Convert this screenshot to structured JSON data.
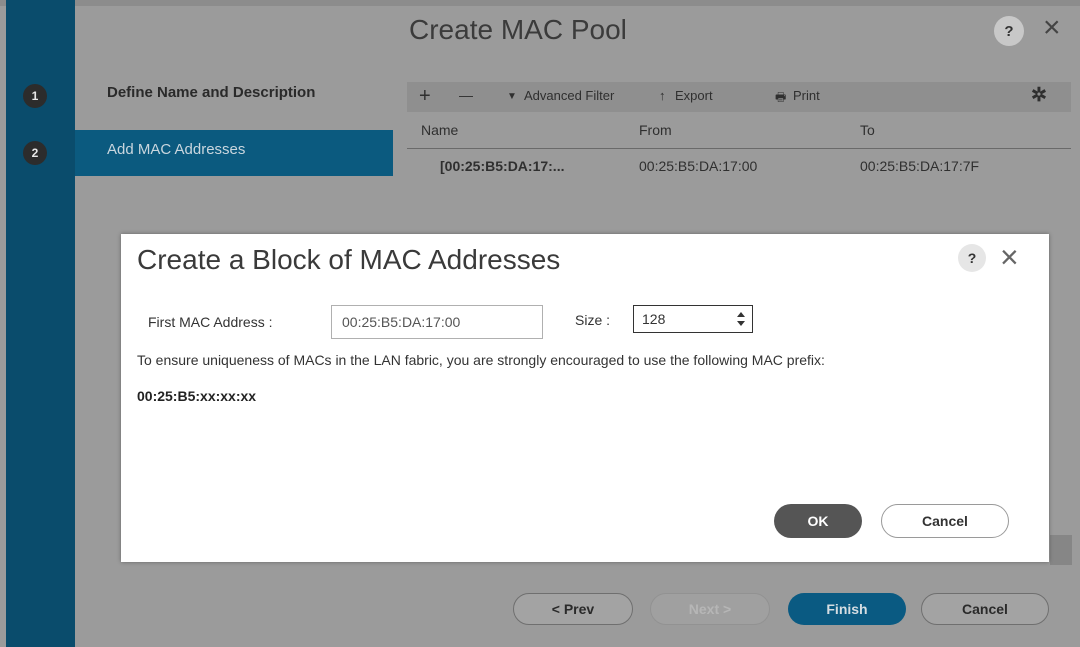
{
  "wizard": {
    "title": "Create MAC Pool",
    "help_label": "?",
    "close_label": "×",
    "steps": [
      {
        "number": "1",
        "label": "Define Name and Description"
      },
      {
        "number": "2",
        "label": "Add MAC Addresses"
      }
    ],
    "toolbar": {
      "add": "+",
      "remove": "—",
      "filter_icon": "▼",
      "filter": "Advanced Filter",
      "export_icon": "↑",
      "export": "Export",
      "print_icon": "🖶",
      "print": "Print",
      "settings_icon": "✲"
    },
    "table": {
      "columns": [
        "Name",
        "From",
        "To"
      ],
      "rows": [
        {
          "name": "[00:25:B5:DA:17:...",
          "from": "00:25:B5:DA:17:00",
          "to": "00:25:B5:DA:17:7F"
        }
      ]
    },
    "buttons": {
      "prev": "< Prev",
      "next": "Next >",
      "finish": "Finish",
      "cancel": "Cancel"
    }
  },
  "dialog": {
    "title": "Create a Block of MAC Addresses",
    "help_label": "?",
    "close_label": "×",
    "first_mac_label": "First MAC Address :",
    "first_mac_value": "00:25:B5:DA:17:00",
    "size_label": "Size :",
    "size_value": "128",
    "message": "To ensure uniqueness of MACs in the LAN fabric, you are strongly encouraged to use the following MAC prefix:",
    "prefix": "00:25:B5:xx:xx:xx",
    "ok": "OK",
    "cancel": "Cancel"
  },
  "colors": {
    "step_bar": "#0a4c6c",
    "step_active": "#0b5a7f",
    "finish_button": "#0a5a82",
    "ok_button": "#555555"
  }
}
